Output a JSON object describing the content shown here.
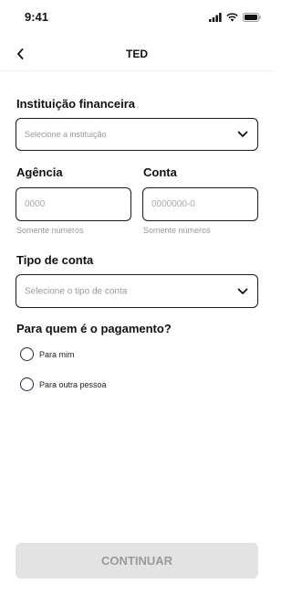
{
  "status_bar": {
    "time": "9:41"
  },
  "nav": {
    "title": "TED"
  },
  "institution": {
    "label": "Instituição financeira",
    "placeholder": "Selecione a instituição"
  },
  "agency": {
    "label": "Agência",
    "placeholder": "0000",
    "helper": "Somente números"
  },
  "account": {
    "label": "Conta",
    "placeholder": "0000000-0",
    "helper": "Somente números"
  },
  "account_type": {
    "label": "Tipo de conta",
    "placeholder": "Selecione o tipo de conta"
  },
  "payee": {
    "question": "Para quem é o pagamento?",
    "options": [
      {
        "label": "Para mim"
      },
      {
        "label": "Para outra pessoa"
      }
    ]
  },
  "footer": {
    "continue_label": "CONTINUAR"
  }
}
